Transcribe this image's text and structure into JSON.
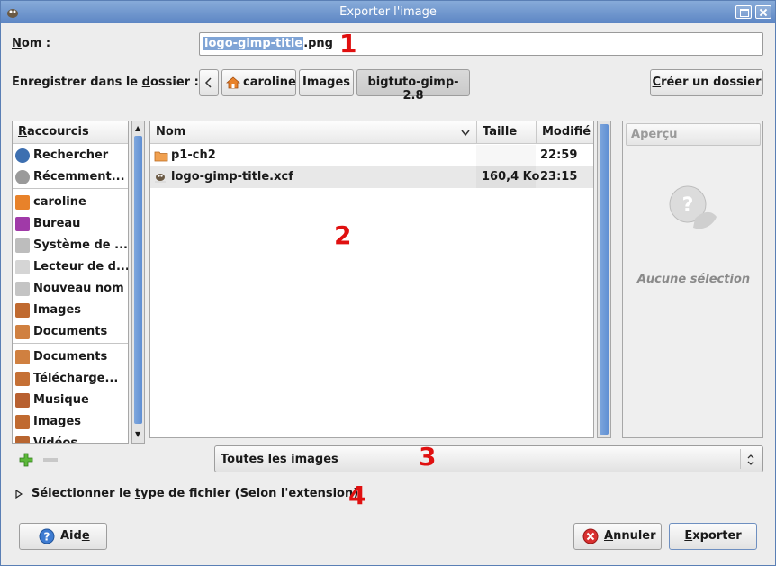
{
  "window": {
    "title": "Exporter l'image"
  },
  "name_row": {
    "label": "Nom :",
    "filename_selected": "logo-gimp-title",
    "filename_ext": ".png"
  },
  "folder_row": {
    "label": "Enregistrer dans le dossier :",
    "crumbs": [
      "caroline",
      "Images",
      "bigtuto-gimp-2.8"
    ],
    "create_folder": "Créer un dossier"
  },
  "sidebar": {
    "header": "Raccourcis",
    "items": [
      "Rechercher",
      "Récemment...",
      "caroline",
      "Bureau",
      "Système de ...",
      "Lecteur de d...",
      "Nouveau nom",
      "Images",
      "Documents",
      "Documents",
      "Télécharge...",
      "Musique",
      "Images",
      "Vidéos"
    ]
  },
  "files": {
    "columns": [
      "Nom",
      "Taille",
      "Modifié"
    ],
    "rows": [
      {
        "name": "p1-ch2",
        "size": "",
        "modified": "22:59"
      },
      {
        "name": "logo-gimp-title.xcf",
        "size": "160,4 Ko",
        "modified": "23:15"
      }
    ]
  },
  "preview": {
    "header": "Aperçu",
    "empty_text": "Aucune sélection"
  },
  "filter": {
    "value": "Toutes les images"
  },
  "filetype": {
    "label": "Sélectionner le type de fichier (Selon l'extension)"
  },
  "footer": {
    "help": "Aide",
    "cancel": "Annuler",
    "export": "Exporter"
  },
  "annotations": [
    "1",
    "2",
    "3",
    "4"
  ]
}
